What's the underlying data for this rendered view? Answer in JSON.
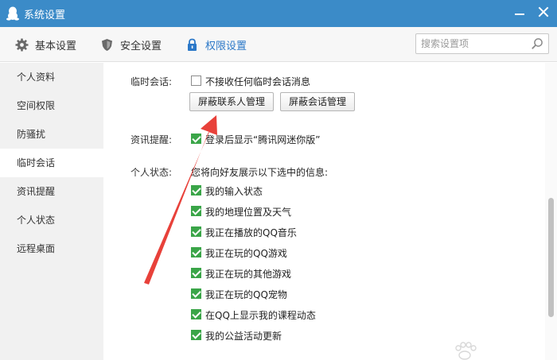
{
  "window": {
    "title": "系统设置"
  },
  "toolbar": {
    "tabs": [
      {
        "label": "基本设置",
        "icon": "gear-icon"
      },
      {
        "label": "安全设置",
        "icon": "shield-icon"
      },
      {
        "label": "权限设置",
        "icon": "lock-icon"
      }
    ],
    "search_placeholder": "搜索设置项"
  },
  "sidebar": {
    "items": [
      {
        "label": "个人资料"
      },
      {
        "label": "空间权限"
      },
      {
        "label": "防骚扰"
      },
      {
        "label": "临时会话",
        "active": true
      },
      {
        "label": "资讯提醒"
      },
      {
        "label": "个人状态"
      },
      {
        "label": "远程桌面"
      }
    ]
  },
  "temp_chat": {
    "label": "临时会话:",
    "option": {
      "text": "不接收任何临时会话消息",
      "checked": false
    },
    "buttons": [
      "屏蔽联系人管理",
      "屏蔽会话管理"
    ]
  },
  "news": {
    "label": "资讯提醒:",
    "option": {
      "text": "登录后显示“腾讯网迷你版”",
      "checked": true
    }
  },
  "status": {
    "label": "个人状态:",
    "desc": "您将向好友展示以下选中的信息:",
    "options": [
      {
        "text": "我的输入状态",
        "checked": true
      },
      {
        "text": "我的地理位置及天气",
        "checked": true
      },
      {
        "text": "我正在播放的QQ音乐",
        "checked": true
      },
      {
        "text": "我正在玩的QQ游戏",
        "checked": true
      },
      {
        "text": "我正在玩的其他游戏",
        "checked": true
      },
      {
        "text": "我正在玩的QQ宠物",
        "checked": true
      },
      {
        "text": "在QQ上显示我的课程动态",
        "checked": true
      },
      {
        "text": "我的公益活动更新",
        "checked": true
      }
    ]
  },
  "colors": {
    "titlebar": "#3b8bc8",
    "accent": "#2b78c8",
    "checkbox_checked": "#3aa548",
    "arrow": "#e8413a"
  }
}
